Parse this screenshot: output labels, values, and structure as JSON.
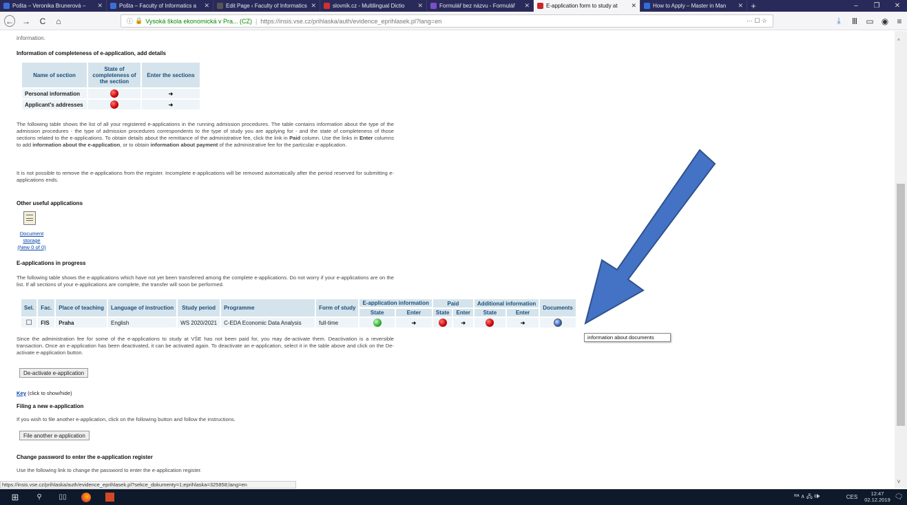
{
  "browser": {
    "tabs": [
      {
        "title": "Pošta – Veronika Brunerová – ",
        "color": "#3a6fd8",
        "active": false
      },
      {
        "title": "Pošta – Faculty of Informatics a",
        "color": "#3a6fd8",
        "active": false
      },
      {
        "title": "Edit Page ‹ Faculty of Informatics a",
        "color": "#2a2a5a",
        "active": false
      },
      {
        "title": "slovník.cz - Multilingual Dictio",
        "color": "#d03030",
        "active": false
      },
      {
        "title": "Formulář bez názvu - Formulář",
        "color": "#7b4fc9",
        "active": false
      },
      {
        "title": "E-application form to study at",
        "color": "#c62828",
        "active": true
      },
      {
        "title": "How to Apply – Master in Man",
        "color": "#2f6fdc",
        "active": false
      }
    ],
    "new_tab": "+",
    "win_min": "–",
    "win_max": "❐",
    "win_close": "✕",
    "back": "←",
    "forward": "→",
    "reload": "C",
    "home": "⌂",
    "site_label": "Vysoká škola ekonomická v Pra... (CZ)",
    "url": "https://insis.vse.cz/prihlaska/auth/evidence_eprihlasek.pl?lang=en",
    "url_host": "insis.vse.cz",
    "url_more": "···",
    "status_url": "https://insis.vse.cz/prihlaska/auth/evidence_eprihlasek.pl?sekce_dokumenty=1;eprihlaska=325858;lang=en"
  },
  "page": {
    "cut_top": "information.",
    "completeness_heading": "Information of completeness of e-application, add details",
    "completeness_headers": [
      "Name of section",
      "State of completeness of the section",
      "Enter the sections"
    ],
    "completeness_rows": [
      {
        "name": "Personal information",
        "state": "red",
        "enter": "➜"
      },
      {
        "name": "Applicant's addresses",
        "state": "red",
        "enter": "➜"
      }
    ],
    "para1_a": "The following table shows the list of all your registered e-applications in the running admission procedures. The table contains information about the type of the admission procedures - the type of admission procedures correspondents to the type of study you are applying for - and the state of completeness of those sections related to the e-applications. To obtain details about the remittance of the administrative fee, click the link in ",
    "para1_paid": "Paid",
    "para1_b": " column. Use the links in ",
    "para1_enter": "Enter",
    "para1_c": " columns to add ",
    "para1_info": "information about the e-application",
    "para1_d": ", or to obtain ",
    "para1_pay": "information about payment",
    "para1_e": " of the administrative fee for the particular e-application.",
    "para2": "It is not possible to remove the e-applications from the register. Incomplete e-applications will be removed automatically after the period reserved for submitting e-applications ends.",
    "useful_heading": "Other useful applications",
    "doc_storage_1": "Document",
    "doc_storage_2": "storage",
    "doc_storage_3": "(New 0 of 0)",
    "inprogress_heading": "E-applications in progress",
    "para3": "The following table shows the e-applications which have not yet been transferred among the complete e-applications. Do not worry if your e-applications are on the list. If all sections of your e-applications are complete, the transfer will soon be performed.",
    "app_table": {
      "h_sel": "Sel.",
      "h_fac": "Fac.",
      "h_place": "Place of teaching",
      "h_lang": "Language of instruction",
      "h_period": "Study period",
      "h_prog": "Programme",
      "h_form": "Form of study",
      "h_einfo": "E-application information",
      "h_paid": "Paid",
      "h_add": "Additional information",
      "h_docs": "Documents",
      "h_state": "State",
      "h_enter": "Enter",
      "row": {
        "sel": "☐",
        "fac": "FIS",
        "place": "Praha",
        "lang": "English",
        "period": "WS 2020/2021",
        "prog": "C-EDA Economic Data Analysis",
        "form": "full-time",
        "enter": "➜"
      }
    },
    "tooltip": "information about documents",
    "para4": "Since the administration fee for some of the e-applications to study at VŠE has not been paid for, you may de-activate them. Deactivation is a reversible transaction. Once an e-application has been deactivated, it can be activated again. To deactivate an e-application, select it in the table above and click on the De-activate e-application button.",
    "deactivate_btn": "De-activate e-application",
    "key_link": "Key",
    "key_note": "(click to show/hide)",
    "filing_heading": "Filing a new e-application",
    "filing_text": "If you wish to file another e-application, click on the following button and follow the instructions.",
    "file_btn": "File another e-application",
    "pw_heading": "Change password to enter the e-application register",
    "pw_text": "Use the following link to change the password to enter the e-application register."
  },
  "taskbar": {
    "start": "⊞",
    "search": "⚲",
    "lang": "CES",
    "time": "12:47",
    "date": "02.12.2019",
    "notif": "🗨",
    "sys": "ᴿᴬ ∧ 🖧 🕪"
  },
  "colors": {
    "arrow": "#4472c4",
    "table_head": "#d5e4ec",
    "link": "#0645ad"
  }
}
